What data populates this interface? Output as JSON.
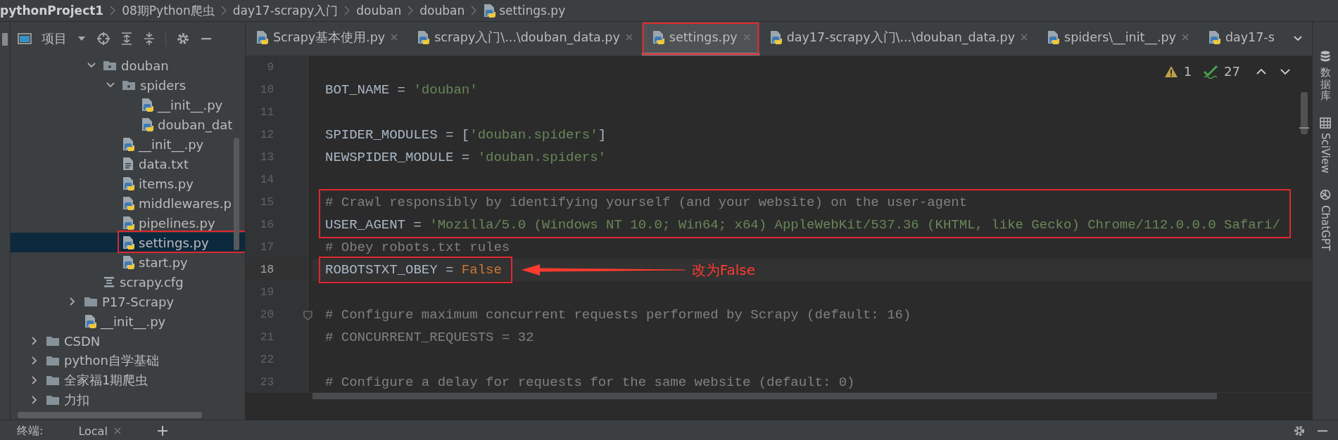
{
  "breadcrumb": [
    {
      "label": "pythonProject1",
      "kind": "project"
    },
    {
      "label": "08期Python爬虫",
      "kind": "folder"
    },
    {
      "label": "day17-scrapy入门",
      "kind": "folder"
    },
    {
      "label": "douban",
      "kind": "folder"
    },
    {
      "label": "douban",
      "kind": "folder"
    },
    {
      "label": "settings.py",
      "kind": "python"
    }
  ],
  "project_panel": {
    "title": "项目",
    "tree": [
      {
        "children": [
          {
            "children": [
              {
                "children": [
                  {
                    "label": "douban",
                    "kind": "package",
                    "expanded": true,
                    "selected": false,
                    "boxed": false,
                    "children": [
                      {
                        "label": "spiders",
                        "kind": "package",
                        "expanded": true,
                        "selected": false,
                        "boxed": false,
                        "children": [
                          {
                            "label": "__init__.py",
                            "kind": "python",
                            "selected": false,
                            "boxed": false
                          },
                          {
                            "label": "douban_dat",
                            "kind": "python",
                            "selected": false,
                            "boxed": false
                          }
                        ]
                      },
                      {
                        "label": "__init__.py",
                        "kind": "python",
                        "selected": false,
                        "boxed": false
                      },
                      {
                        "label": "data.txt",
                        "kind": "text",
                        "selected": false,
                        "boxed": false
                      },
                      {
                        "label": "items.py",
                        "kind": "python",
                        "selected": false,
                        "boxed": false
                      },
                      {
                        "label": "middlewares.p",
                        "kind": "python",
                        "selected": false,
                        "boxed": false
                      },
                      {
                        "label": "pipelines.py",
                        "kind": "python",
                        "selected": false,
                        "boxed": false
                      },
                      {
                        "label": "settings.py",
                        "kind": "python",
                        "selected": true,
                        "boxed": true
                      },
                      {
                        "label": "start.py",
                        "kind": "python",
                        "selected": false,
                        "boxed": false
                      }
                    ]
                  },
                  {
                    "label": "scrapy.cfg",
                    "kind": "config",
                    "selected": false,
                    "boxed": false
                  }
                ]
              },
              {
                "label": "P17-Scrapy",
                "kind": "folder",
                "expanded": false,
                "selected": false,
                "boxed": false
              },
              {
                "label": "__init__.py",
                "kind": "python",
                "selected": false,
                "boxed": false
              }
            ]
          }
        ]
      },
      {
        "label": "CSDN",
        "kind": "folder",
        "expanded": false,
        "selected": false,
        "boxed": false
      },
      {
        "label": "python自学基础",
        "kind": "folder",
        "expanded": false,
        "selected": false,
        "boxed": false
      },
      {
        "label": "全家福1期爬虫",
        "kind": "folder",
        "expanded": false,
        "selected": false,
        "boxed": false
      },
      {
        "label": "力扣",
        "kind": "folder",
        "expanded": false,
        "selected": false,
        "boxed": false
      }
    ]
  },
  "tabs": [
    {
      "label": "Scrapy基本使用.py",
      "selected": false,
      "boxed": false,
      "closable": true
    },
    {
      "label": "scrapy入门\\...\\douban_data.py",
      "selected": false,
      "boxed": false,
      "closable": true
    },
    {
      "label": "settings.py",
      "selected": true,
      "boxed": true,
      "closable": true
    },
    {
      "label": "day17-scrapy入门\\...\\douban_data.py",
      "selected": false,
      "boxed": false,
      "closable": true
    },
    {
      "label": "spiders\\__init__.py",
      "selected": false,
      "boxed": false,
      "closable": true
    },
    {
      "label": "day17-s",
      "selected": false,
      "boxed": false,
      "closable": false
    }
  ],
  "inspections": {
    "warnings": "1",
    "checks": "27"
  },
  "code_lines": [
    {
      "number": "9",
      "current": false,
      "boxed": false,
      "fold": false
    },
    {
      "number": "10",
      "current": false,
      "boxed": false,
      "fold": false,
      "tokens": [
        {
          "text": "BOT_NAME = ",
          "kind": "plain"
        },
        {
          "text": "'douban'",
          "kind": "string"
        }
      ]
    },
    {
      "number": "11",
      "current": false,
      "boxed": false,
      "fold": false
    },
    {
      "number": "12",
      "current": false,
      "boxed": false,
      "fold": false,
      "tokens": [
        {
          "text": "SPIDER_MODULES = [",
          "kind": "plain"
        },
        {
          "text": "'douban.spiders'",
          "kind": "string"
        },
        {
          "text": "]",
          "kind": "plain"
        }
      ]
    },
    {
      "number": "13",
      "current": false,
      "boxed": false,
      "fold": false,
      "tokens": [
        {
          "text": "NEWSPIDER_MODULE = ",
          "kind": "plain"
        },
        {
          "text": "'douban.spiders'",
          "kind": "string"
        }
      ]
    },
    {
      "number": "14",
      "current": false,
      "boxed": false,
      "fold": false
    },
    {
      "number": "15",
      "current": false,
      "boxed": true,
      "fold": false,
      "tokens": [
        {
          "text": "# Crawl responsibly by identifying yourself (and your website) on the user-agent",
          "kind": "comment"
        }
      ]
    },
    {
      "number": "16",
      "current": false,
      "boxed": true,
      "fold": false,
      "tokens": [
        {
          "text": "USER_AGENT = ",
          "kind": "plain"
        },
        {
          "text": "'Mozilla/5.0 (Windows NT 10.0; Win64; x64) AppleWebKit/537.36 (KHTML, like Gecko) Chrome/112.0.0.0 Safari/",
          "kind": "string"
        }
      ]
    },
    {
      "number": "17",
      "current": false,
      "boxed": false,
      "fold": false,
      "tokens": [
        {
          "text": "# Obey robots.txt rules",
          "kind": "comment"
        }
      ]
    },
    {
      "number": "18",
      "current": true,
      "boxed": true,
      "fold": false,
      "note": "改为False",
      "tokens": [
        {
          "text": "ROBOTSTXT_OBEY = ",
          "kind": "plain"
        },
        {
          "text": "False",
          "kind": "keyword"
        }
      ]
    },
    {
      "number": "19",
      "current": false,
      "boxed": false,
      "fold": false
    },
    {
      "number": "20",
      "current": false,
      "boxed": false,
      "fold": true,
      "tokens": [
        {
          "text": "# Configure maximum concurrent requests performed by Scrapy (default: 16)",
          "kind": "comment"
        }
      ]
    },
    {
      "number": "21",
      "current": false,
      "boxed": false,
      "fold": false,
      "tokens": [
        {
          "text": "# CONCURRENT_REQUESTS = 32",
          "kind": "comment"
        }
      ]
    },
    {
      "number": "22",
      "current": false,
      "boxed": false,
      "fold": false
    },
    {
      "number": "23",
      "current": false,
      "boxed": false,
      "fold": false,
      "tokens": [
        {
          "text": "# Configure a delay for requests for the same website (default: 0)",
          "kind": "comment"
        }
      ]
    }
  ],
  "side_tools": [
    {
      "label": "数据库",
      "kind": "database"
    },
    {
      "label": "SciView",
      "kind": "sciview"
    },
    {
      "label": "ChatGPT",
      "kind": "chatgpt"
    }
  ],
  "bottom_bar": {
    "title": "终端:",
    "tab": "Local"
  }
}
